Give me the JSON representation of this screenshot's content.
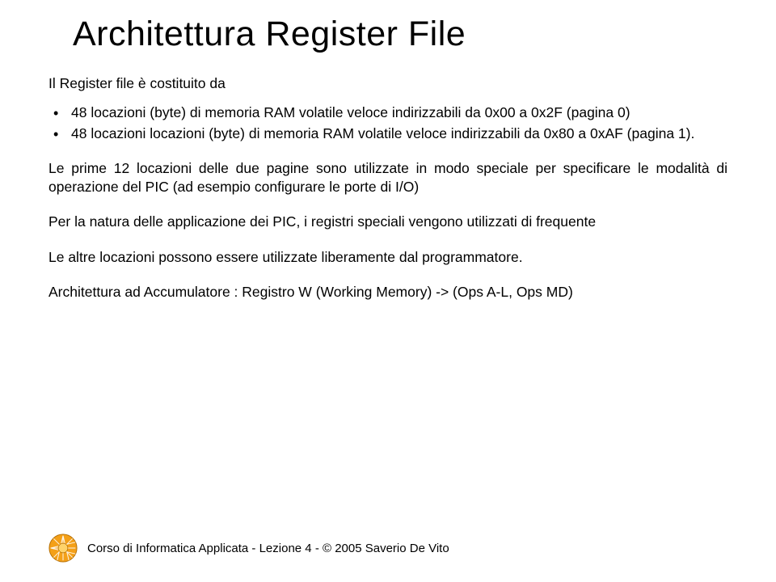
{
  "title": "Architettura Register File",
  "intro": "Il Register file è costituito da",
  "bullets": [
    "48 locazioni (byte) di memoria RAM volatile veloce indirizzabili da 0x00 a 0x2F    (pagina 0)",
    "48 locazioni locazioni (byte) di memoria RAM volatile veloce indirizzabili da    0x80 a 0xAF (pagina 1)."
  ],
  "para1": "Le prime 12 locazioni delle due pagine sono utilizzate in modo speciale per specificare le modalità di operazione del PIC (ad esempio configurare le porte di I/O)",
  "para2": "Per la natura delle applicazione dei PIC, i registri speciali vengono utilizzati di frequente",
  "para3": "Le altre locazioni possono essere utilizzate liberamente dal programmatore.",
  "para4": "Architettura ad Accumulatore : Registro W  (Working Memory) -> (Ops A-L, Ops MD)",
  "footer": "Corso di Informatica Applicata  - Lezione 4 -  © 2005 Saverio De Vito"
}
